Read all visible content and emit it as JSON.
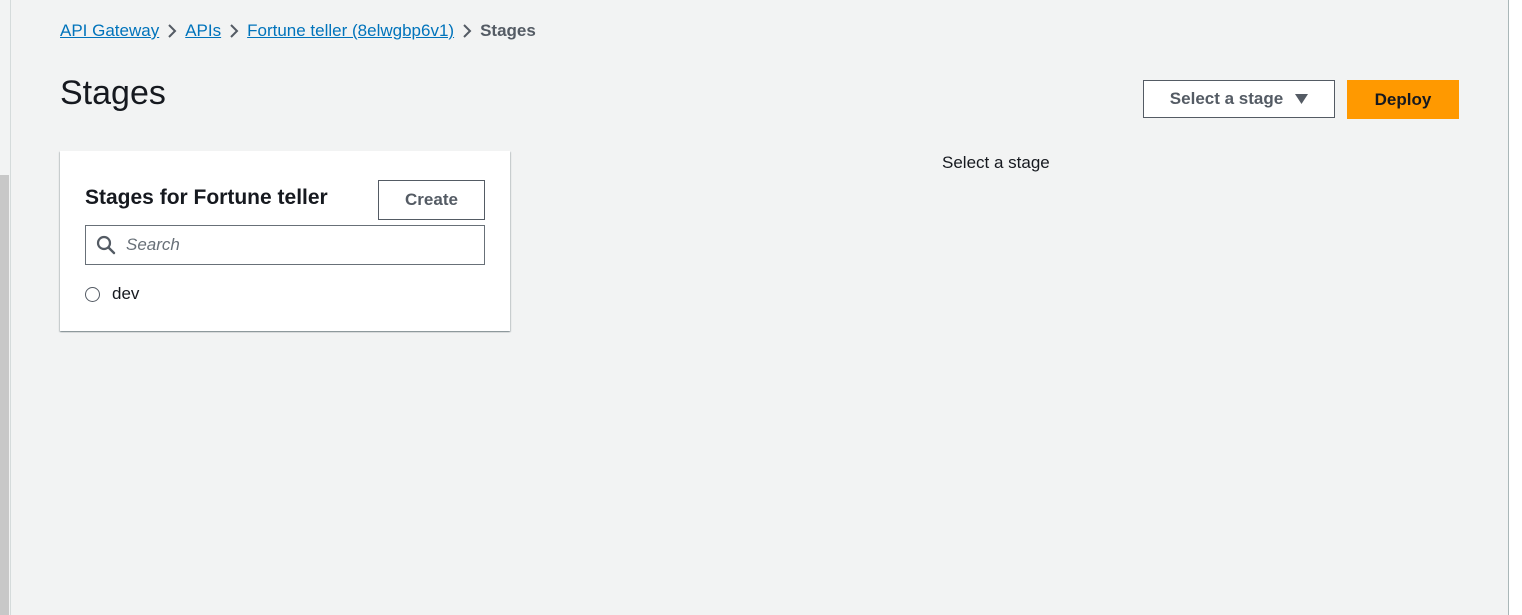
{
  "breadcrumb": {
    "items": [
      {
        "label": "API Gateway"
      },
      {
        "label": "APIs"
      },
      {
        "label": "Fortune teller (8elwgbp6v1)"
      }
    ],
    "current": "Stages"
  },
  "page": {
    "title": "Stages"
  },
  "header_actions": {
    "stage_select_label": "Select a stage",
    "deploy_label": "Deploy"
  },
  "panel": {
    "title": "Stages for Fortune teller",
    "create_label": "Create",
    "search_placeholder": "Search",
    "stages": [
      {
        "name": "dev",
        "selected": false
      }
    ]
  },
  "detail": {
    "empty_message": "Select a stage"
  },
  "colors": {
    "link": "#0073bb",
    "primary_button": "#ff9900",
    "background": "#f2f3f3"
  }
}
